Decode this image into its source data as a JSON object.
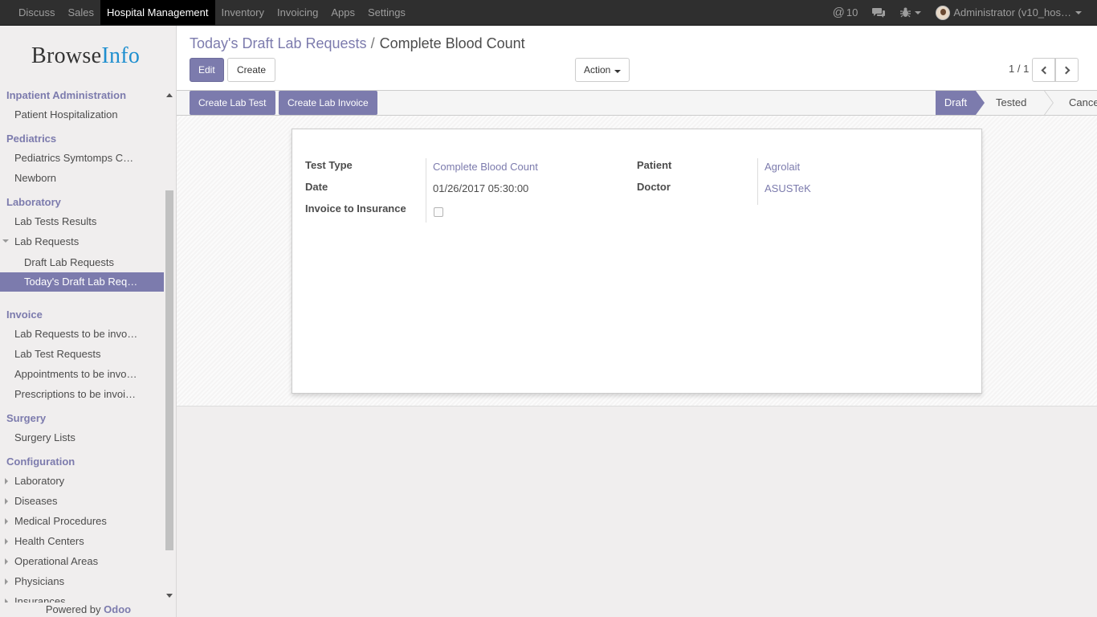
{
  "topbar": {
    "menu": [
      "Discuss",
      "Sales",
      "Hospital Management",
      "Inventory",
      "Invoicing",
      "Apps",
      "Settings"
    ],
    "active_menu": "Hospital Management",
    "notifications": "10",
    "user": "Administrator (v10_hos…"
  },
  "sidebar": {
    "logo_browse": "Browse",
    "logo_info": "Info",
    "sections": {
      "inpatient": "Inpatient Administration",
      "pediatrics": "Pediatrics",
      "laboratory": "Laboratory",
      "invoice": "Invoice",
      "surgery": "Surgery",
      "configuration": "Configuration"
    },
    "items": {
      "patient_hosp": "Patient Hospitalization",
      "ped_symptoms": "Pediatrics Symtomps C…",
      "newborn": "Newborn",
      "lab_results": "Lab Tests Results",
      "lab_requests": "Lab Requests",
      "draft_lab": "Draft Lab Requests",
      "today_draft": "Today's Draft Lab Req…",
      "lab_req_invoice": "Lab Requests to be invo…",
      "lab_test_requests": "Lab Test Requests",
      "appointments_inv": "Appointments to be invo…",
      "prescriptions_inv": "Prescriptions to be invoi…",
      "surgery_lists": "Surgery Lists",
      "cfg_laboratory": "Laboratory",
      "cfg_diseases": "Diseases",
      "cfg_medical": "Medical Procedures",
      "cfg_health": "Health Centers",
      "cfg_operational": "Operational Areas",
      "cfg_physicians": "Physicians",
      "cfg_insurances": "Insurances"
    },
    "powered_by": "Powered by",
    "powered_brand": "Odoo"
  },
  "breadcrumb": {
    "parent": "Today's Draft Lab Requests",
    "separator": "/",
    "current": "Complete Blood Count"
  },
  "buttons": {
    "edit": "Edit",
    "create": "Create",
    "action": "Action",
    "create_lab_test": "Create Lab Test",
    "create_lab_invoice": "Create Lab Invoice"
  },
  "pager": {
    "value": "1 / 1"
  },
  "status": {
    "stages": [
      "Draft",
      "Tested",
      "Cancel"
    ],
    "current": "Draft"
  },
  "form": {
    "test_type_label": "Test Type",
    "test_type": "Complete Blood Count",
    "date_label": "Date",
    "date": "01/26/2017 05:30:00",
    "invoice_insurance_label": "Invoice to Insurance",
    "invoice_insurance": false,
    "patient_label": "Patient",
    "patient": "Agrolait",
    "doctor_label": "Doctor",
    "doctor": "ASUSTeK"
  },
  "colors": {
    "primary": "#7c7bad",
    "navbar": "#2f2f2f"
  }
}
